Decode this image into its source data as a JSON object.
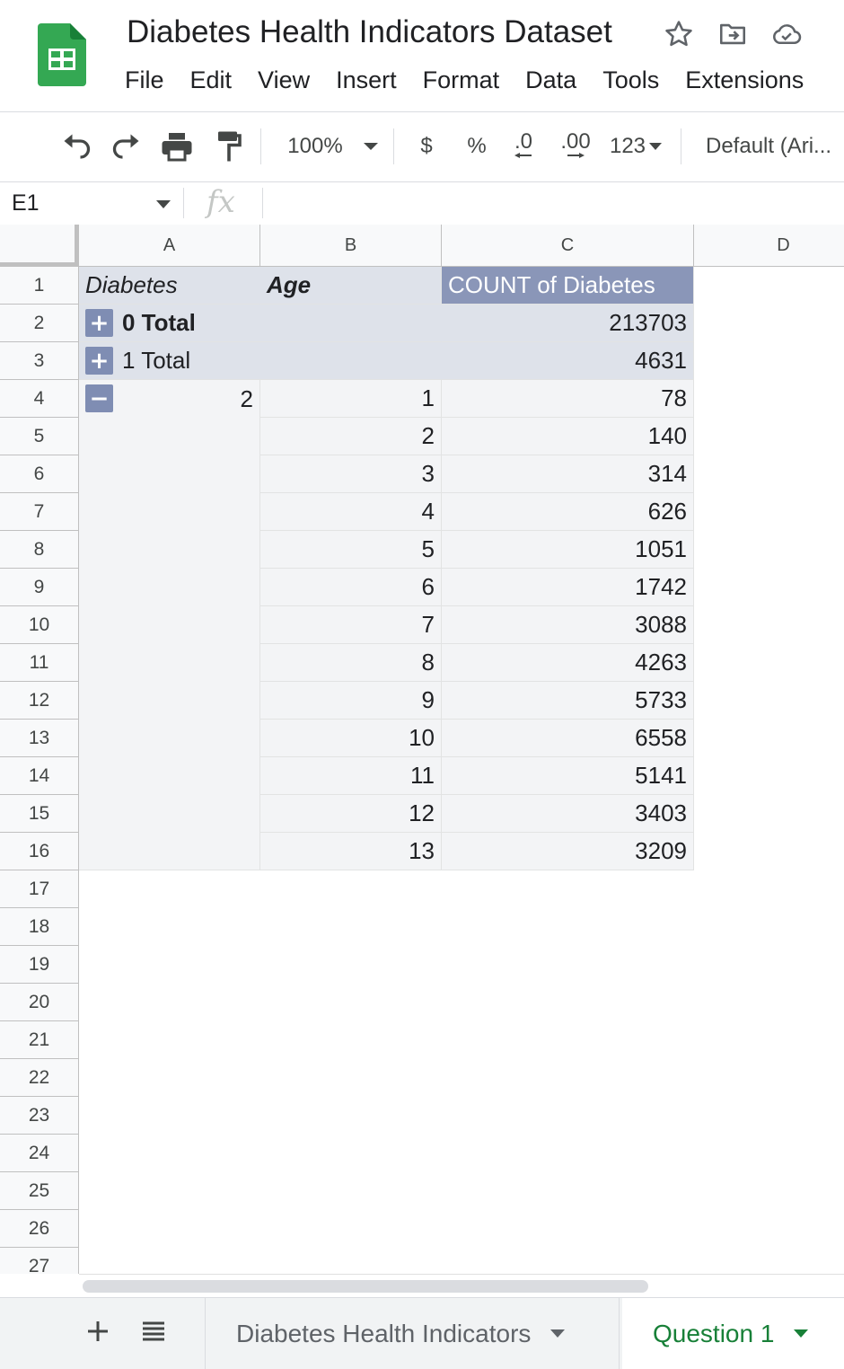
{
  "document": {
    "title": "Diabetes Health Indicators Dataset",
    "icons": [
      "star-icon",
      "move-to-folder-icon",
      "cloud-saved-icon"
    ],
    "brand_color": "#0f9d58"
  },
  "menu": [
    "File",
    "Edit",
    "View",
    "Insert",
    "Format",
    "Data",
    "Tools",
    "Extensions"
  ],
  "toolbar": {
    "zoom": "100%",
    "currency": "$",
    "percent": "%",
    "decrease_decimal": ".0",
    "increase_decimal": ".00",
    "number_format": "123",
    "font": "Default (Ari..."
  },
  "formula_bar": {
    "name_box": "E1",
    "fx": "fx",
    "value": ""
  },
  "columns": [
    "A",
    "B",
    "C",
    "D"
  ],
  "rows": [
    "1",
    "2",
    "3",
    "4",
    "5",
    "6",
    "7",
    "8",
    "9",
    "10",
    "11",
    "12",
    "13",
    "14",
    "15",
    "16",
    "17",
    "18",
    "19",
    "20",
    "21",
    "22",
    "23",
    "24",
    "25",
    "26",
    "27"
  ],
  "pivot": {
    "header": {
      "diabetes": "Diabetes",
      "age": "Age",
      "count": "COUNT of Diabetes"
    },
    "totals": [
      {
        "label": "0 Total",
        "value": "213703",
        "bold": true
      },
      {
        "label": "1 Total",
        "value": "4631",
        "bold": false
      }
    ],
    "expanded_group": "2",
    "rows": [
      {
        "age": "1",
        "count": "78"
      },
      {
        "age": "2",
        "count": "140"
      },
      {
        "age": "3",
        "count": "314"
      },
      {
        "age": "4",
        "count": "626"
      },
      {
        "age": "5",
        "count": "1051"
      },
      {
        "age": "6",
        "count": "1742"
      },
      {
        "age": "7",
        "count": "3088"
      },
      {
        "age": "8",
        "count": "4263"
      },
      {
        "age": "9",
        "count": "5733"
      },
      {
        "age": "10",
        "count": "6558"
      },
      {
        "age": "11",
        "count": "5141"
      },
      {
        "age": "12",
        "count": "3403"
      },
      {
        "age": "13",
        "count": "3209"
      }
    ],
    "colors": {
      "header_bg": "#dee2ea",
      "value_header_bg": "#8a96b8",
      "body_bg": "#f3f4f6",
      "button_bg": "#7f8db3"
    }
  },
  "sheets": {
    "add_label": "+",
    "tabs": [
      {
        "name": "Diabetes Health Indicators",
        "active": false
      },
      {
        "name": "Question 1",
        "active": true
      }
    ],
    "active_color": "#188038"
  }
}
